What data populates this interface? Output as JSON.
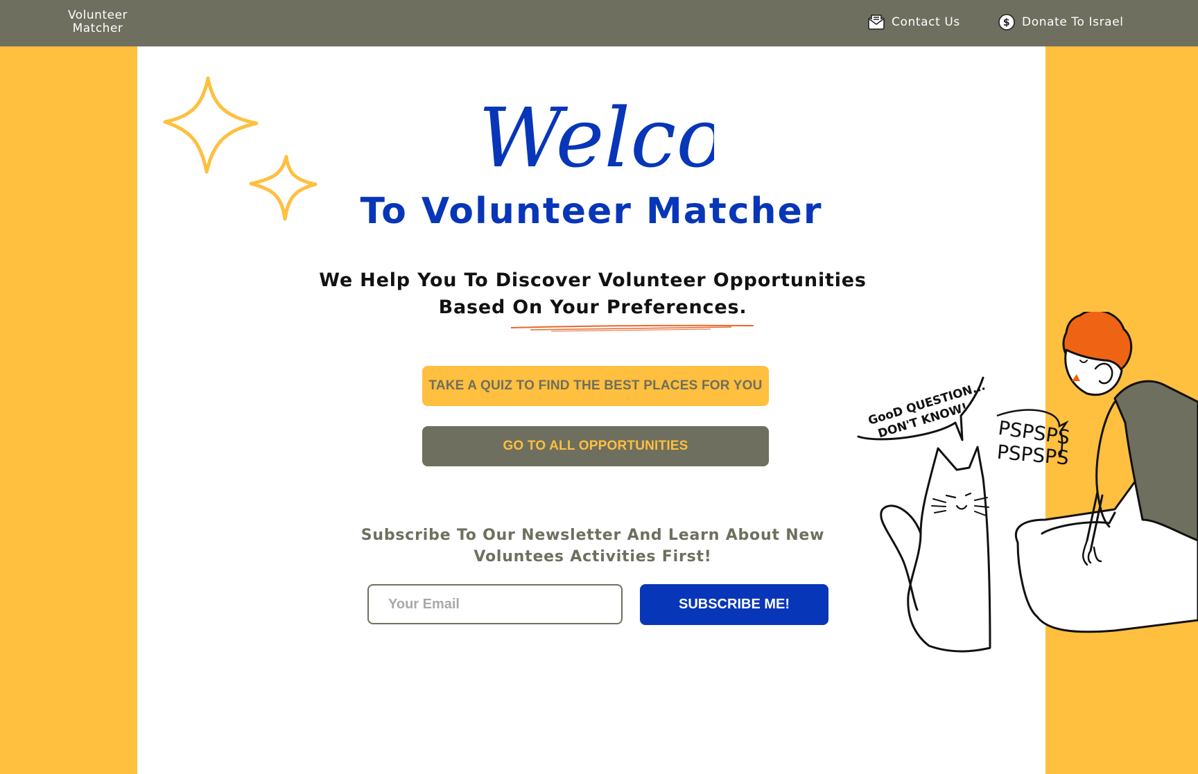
{
  "header": {
    "brand_line1": "Volunteer",
    "brand_line2": "Matcher",
    "contact_label": "Contact Us",
    "contact_icon": "mail-icon",
    "donate_label": "Donate To Israel",
    "donate_icon": "dollar-coin-icon"
  },
  "hero": {
    "welcome": "Welcome",
    "title": "To Volunteer Matcher",
    "tagline_line1": "We Help You To Discover Volunteer Opportunities",
    "tagline_line2": "Based On Your Preferences."
  },
  "actions": {
    "quiz_label": "TAKE A QUIZ TO FIND THE BEST PLACES FOR YOU",
    "all_label": "GO TO ALL OPPORTUNITIES"
  },
  "newsletter": {
    "line1": "Subscribe To Our Newsletter And Learn About New",
    "line2": "Voluntees Activities First!",
    "email_placeholder": "Your Email",
    "email_value": "",
    "subscribe_label": "SUBSCRIBE ME!"
  },
  "illustration": {
    "speech_line1": "GooD QUESTION...",
    "speech_line2": "DON'T KNOW!",
    "call_line1": "PSPSPS",
    "call_line2": "PSPSPS"
  },
  "colors": {
    "accent_yellow": "#ffbf3f",
    "olive": "#6e6f5e",
    "brand_blue": "#0836b8",
    "hair_orange": "#ef6414"
  }
}
